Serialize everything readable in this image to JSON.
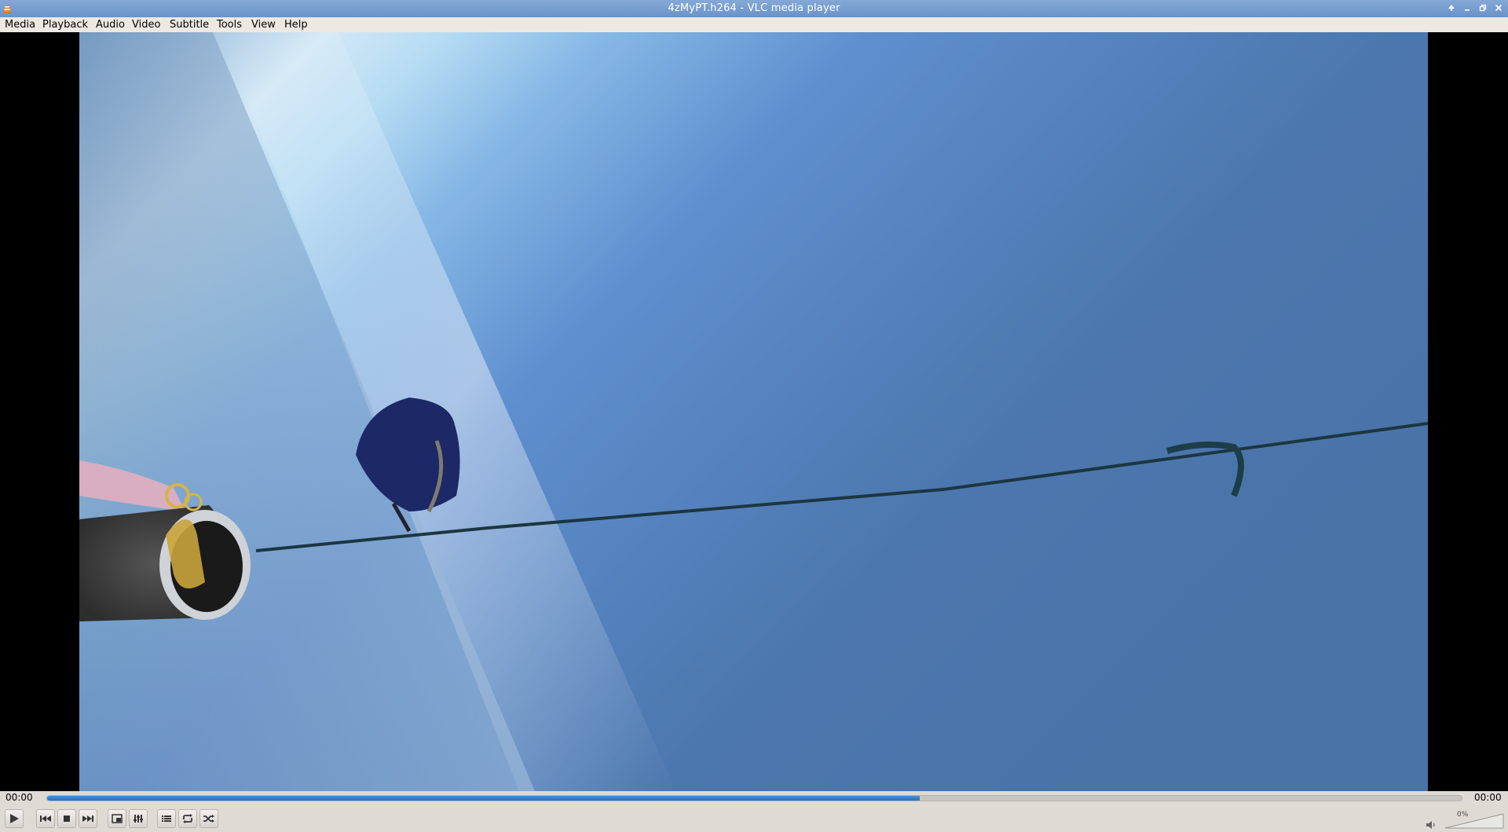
{
  "window": {
    "title": "4zMyPT.h264 - VLC media player"
  },
  "menu": {
    "items": [
      "Media",
      "Playback",
      "Audio",
      "Video",
      "Subtitle",
      "Tools",
      "View",
      "Help"
    ]
  },
  "player": {
    "elapsed": "00:00",
    "total": "00:00",
    "progress": 0.617,
    "volume": "0%"
  },
  "icons": {
    "app": "vlc-cone-icon",
    "play": "play-icon",
    "previous": "skip-previous-icon",
    "stop": "stop-icon",
    "next": "skip-next-icon",
    "fullscreen": "fullscreen-icon",
    "extended": "equalizer-icon",
    "playlist": "playlist-icon",
    "loop": "loop-icon",
    "random": "shuffle-icon",
    "volume": "speaker-icon"
  },
  "colors": {
    "titlebar": "#7a9fd1",
    "seek_fill": "#3b7cc9",
    "chrome": "#dedbd5"
  }
}
